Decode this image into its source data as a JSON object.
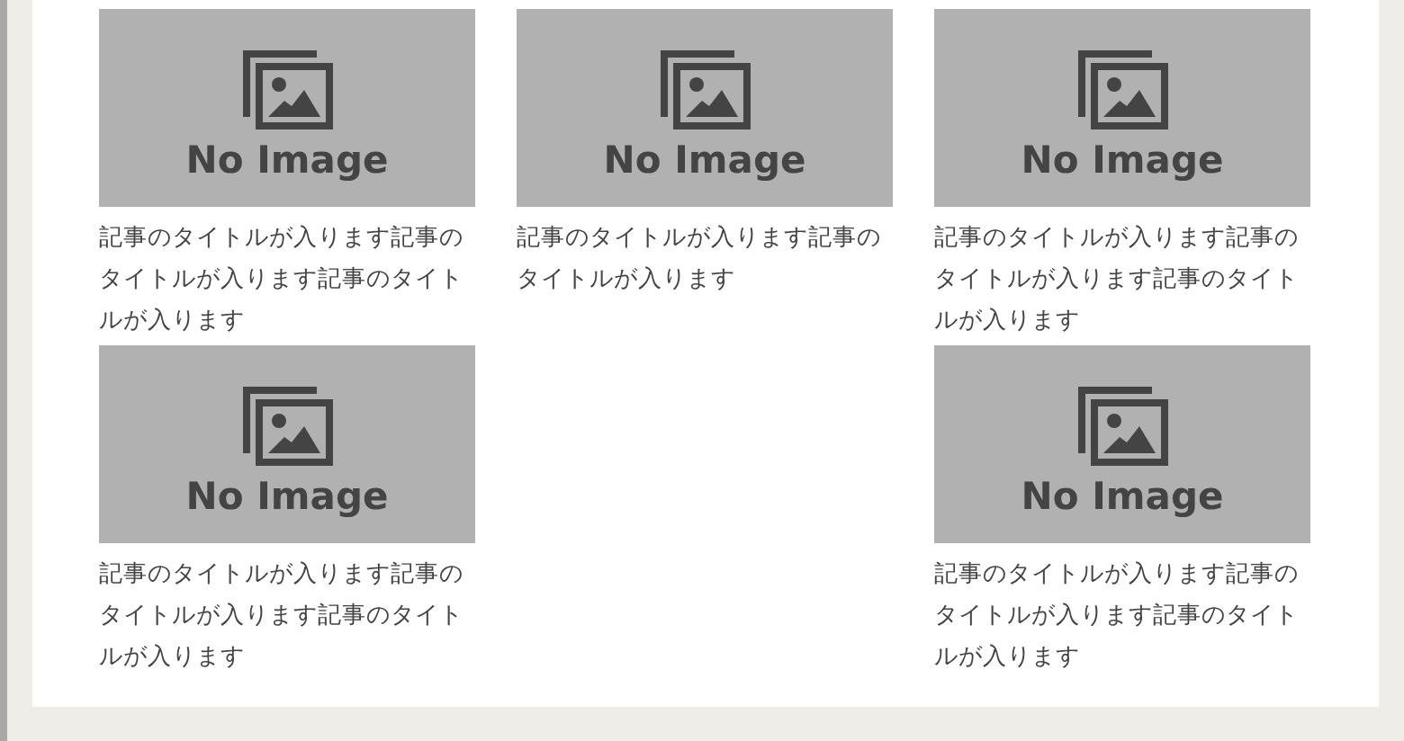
{
  "cards": [
    {
      "kind": "article",
      "image_label": "No Image",
      "title": "記事のタイトルが入ります記事のタイトルが入ります記事のタイトルが入ります"
    },
    {
      "kind": "article",
      "image_label": "No Image",
      "title": "記事のタイトルが入ります記事のタイトルが入ります"
    },
    {
      "kind": "article",
      "image_label": "No Image",
      "title": "記事のタイトルが入ります記事のタイトルが入ります記事のタイトルが入ります"
    },
    {
      "kind": "article",
      "image_label": "No Image",
      "title": "記事のタイトルが入ります記事のタイトルが入ります記事のタイトルが入ります"
    },
    {
      "kind": "empty"
    },
    {
      "kind": "article",
      "image_label": "No Image",
      "title": "記事のタイトルが入ります記事のタイトルが入ります記事のタイトルが入ります"
    }
  ]
}
